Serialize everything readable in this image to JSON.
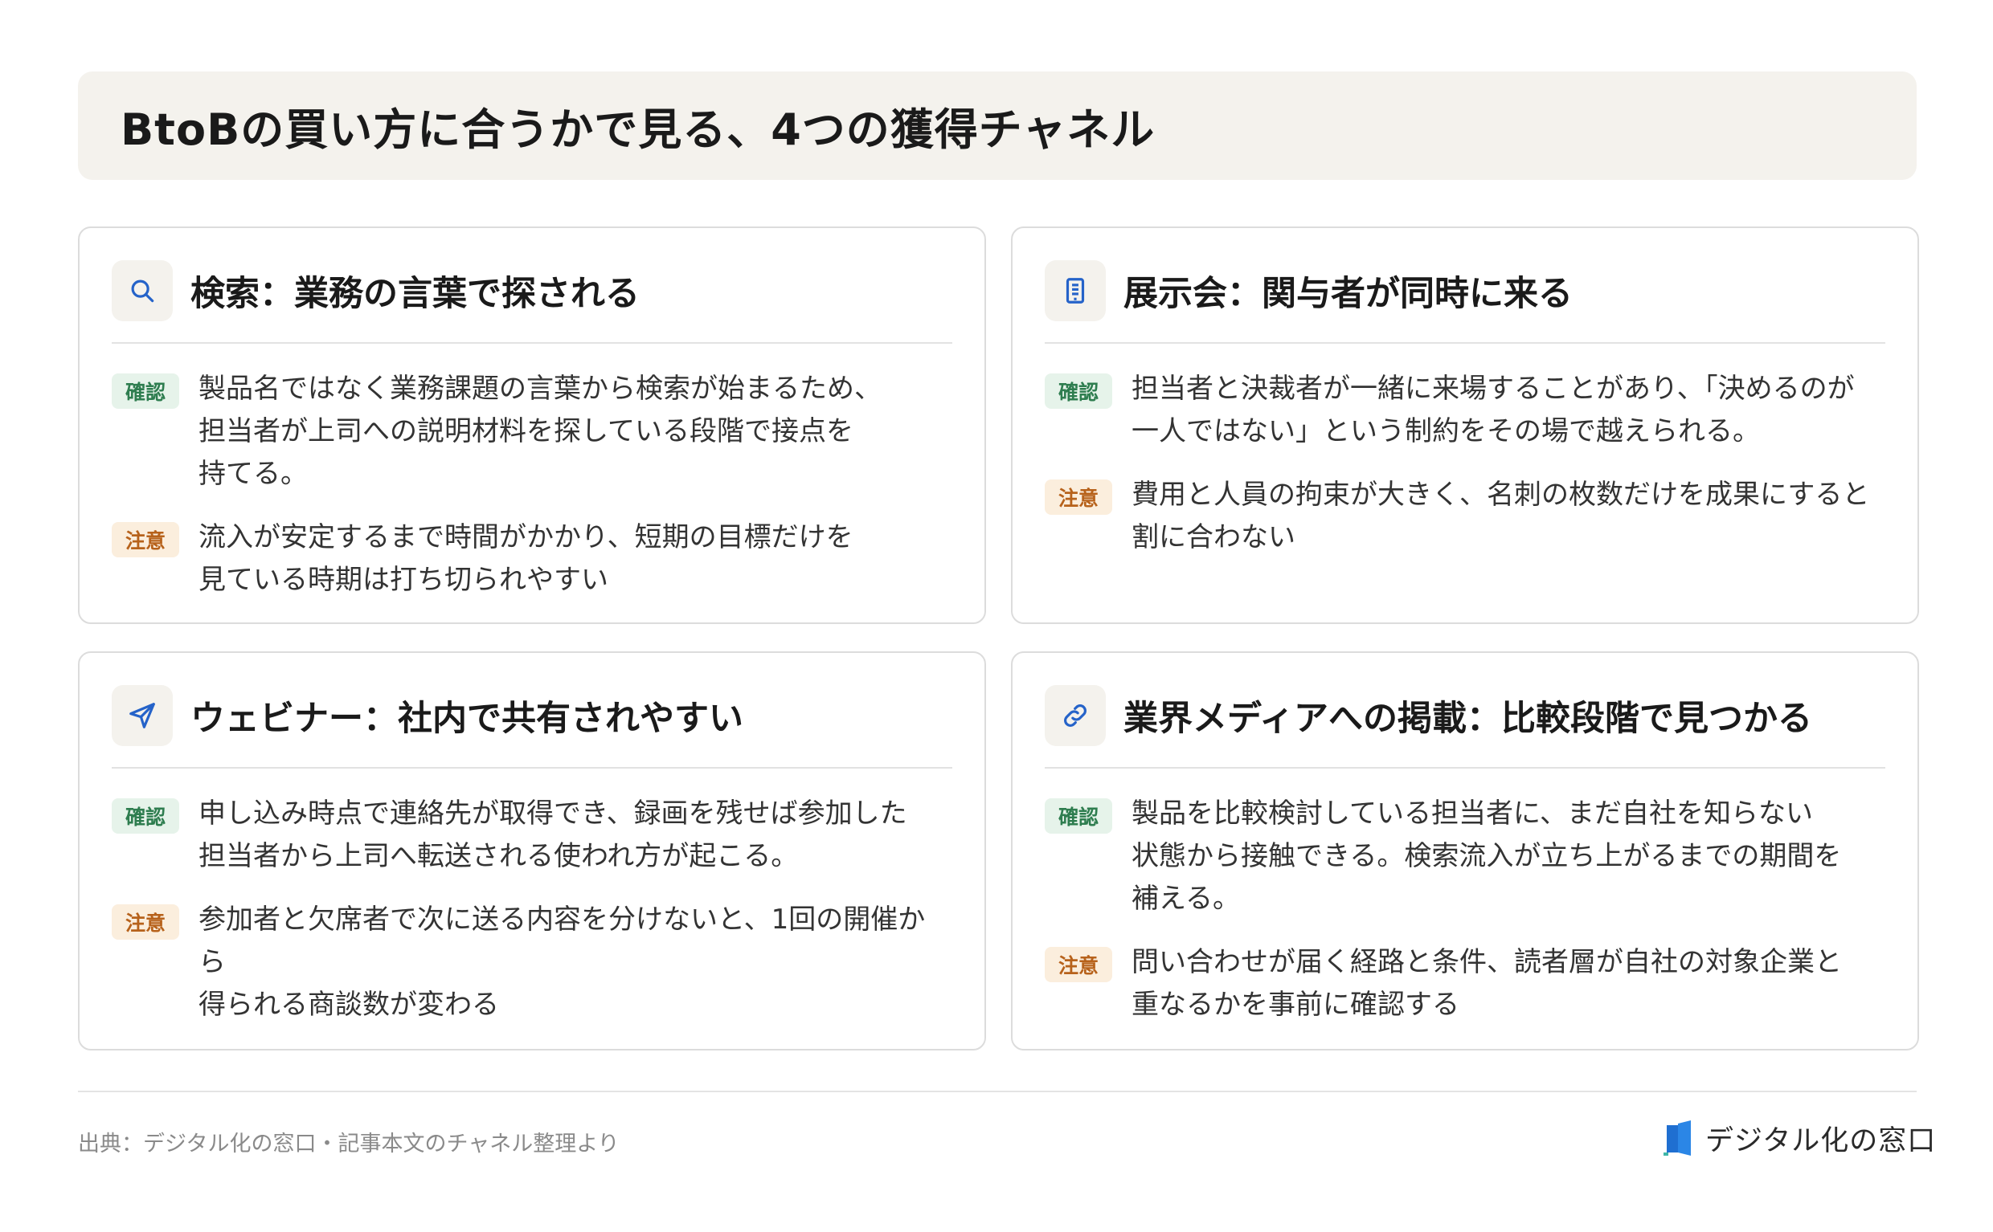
{
  "header": {
    "title": "BtoBの買い方に合うかで見る、4つの獲得チャネル"
  },
  "labels": {
    "confirm": "確認",
    "caution": "注意"
  },
  "cards": [
    {
      "icon": "search-icon",
      "title": "検索：業務の言葉で探される",
      "confirm": "製品名ではなく業務課題の言葉から検索が始まるため、\n担当者が上司への説明材料を探している段階で接点を\n持てる。",
      "caution": "流入が安定するまで時間がかかり、短期の目標だけを\n見ている時期は打ち切られやすい"
    },
    {
      "icon": "building-icon",
      "title": "展示会：関与者が同時に来る",
      "confirm": "担当者と決裁者が一緒に来場することがあり、「決めるのが\n一人ではない」という制約をその場で越えられる。",
      "caution": "費用と人員の拘束が大きく、名刺の枚数だけを成果にすると\n割に合わない"
    },
    {
      "icon": "send-icon",
      "title": "ウェビナー：社内で共有されやすい",
      "confirm": "申し込み時点で連絡先が取得でき、録画を残せば参加した\n担当者から上司へ転送される使われ方が起こる。",
      "caution": "参加者と欠席者で次に送る内容を分けないと、1回の開催から\n得られる商談数が変わる"
    },
    {
      "icon": "link-icon",
      "title": "業界メディアへの掲載：比較段階で見つかる",
      "confirm": "製品を比較検討している担当者に、まだ自社を知らない\n状態から接触できる。検索流入が立ち上がるまでの期間を\n補える。",
      "caution": "問い合わせが届く経路と条件、読者層が自社の対象企業と\n重なるかを事前に確認する"
    }
  ],
  "footer": {
    "source": "出典：デジタル化の窓口・記事本文のチャネル整理より",
    "brand": "デジタル化の窓口"
  },
  "colors": {
    "title_bg": "#f4f2ed",
    "icon_blue": "#2563c9",
    "confirm_bg": "#e6f3ea",
    "confirm_text": "#2e7d4f",
    "caution_bg": "#fbeedd",
    "caution_text": "#b7621b"
  }
}
